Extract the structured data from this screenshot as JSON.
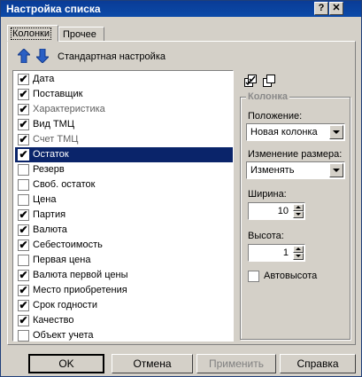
{
  "window": {
    "title": "Настройка списка"
  },
  "tabs": [
    {
      "label": "Колонки",
      "active": true
    },
    {
      "label": "Прочее",
      "active": false
    }
  ],
  "toolbar": {
    "move_up_icon": "arrow-up-icon",
    "move_down_icon": "arrow-down-icon",
    "standard_label": "Стандартная настройка"
  },
  "columns": [
    {
      "label": "Дата",
      "checked": true
    },
    {
      "label": "Поставщик",
      "checked": true
    },
    {
      "label": "Характеристика",
      "checked": true
    },
    {
      "label": "Вид ТМЦ",
      "checked": true
    },
    {
      "label": "Счет ТМЦ",
      "checked": true
    },
    {
      "label": "Остаток",
      "checked": true,
      "selected": true
    },
    {
      "label": "Резерв",
      "checked": false
    },
    {
      "label": "Своб. остаток",
      "checked": false
    },
    {
      "label": "Цена",
      "checked": false
    },
    {
      "label": "Партия",
      "checked": true
    },
    {
      "label": "Валюта",
      "checked": true
    },
    {
      "label": "Себестоимость",
      "checked": true
    },
    {
      "label": "Первая цена",
      "checked": false
    },
    {
      "label": "Валюта первой цены",
      "checked": true
    },
    {
      "label": "Место приобретения",
      "checked": true
    },
    {
      "label": "Срок годности",
      "checked": true
    },
    {
      "label": "Качество",
      "checked": true
    },
    {
      "label": "Объект учета",
      "checked": false
    }
  ],
  "column_group": {
    "title": "Колонка",
    "position_label": "Положение:",
    "position_value": "Новая колонка",
    "resize_label": "Изменение размера:",
    "resize_value": "Изменять",
    "width_label": "Ширина:",
    "width_value": "10",
    "height_label": "Высота:",
    "height_value": "1",
    "autoheight_label": "Автовысота",
    "autoheight_checked": false
  },
  "buttons": {
    "ok": "OK",
    "cancel": "Отмена",
    "apply": "Применить",
    "help": "Справка"
  },
  "colors": {
    "title_bar": "#0a3c96",
    "selection": "#0a246a",
    "face": "#d4d0c8"
  }
}
